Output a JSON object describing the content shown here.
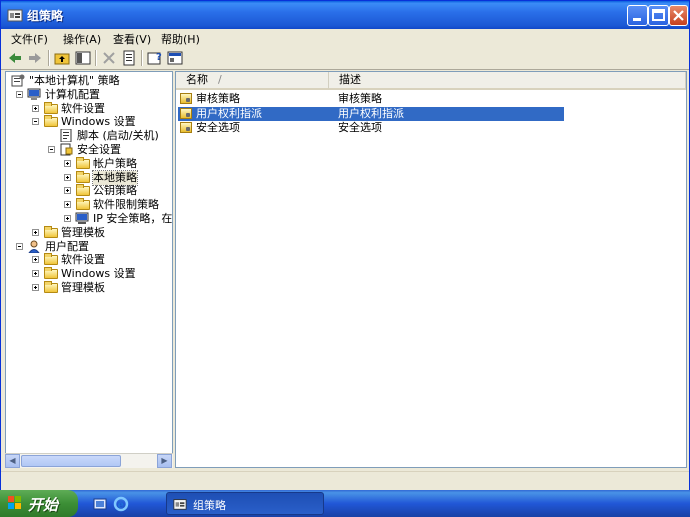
{
  "window": {
    "title": "组策略"
  },
  "menu": [
    {
      "label": "文件(F)"
    },
    {
      "label": "操作(A)"
    },
    {
      "label": "查看(V)"
    },
    {
      "label": "帮助(H)"
    }
  ],
  "toolbar": {
    "icons": [
      "back-arrow-icon",
      "forward-arrow-icon",
      "up-folder-icon",
      "show-hide-tree-icon",
      "delete-icon",
      "properties-icon",
      "help-icon",
      "console-icon"
    ]
  },
  "tree": [
    {
      "label": "\"本地计算机\" 策略",
      "level": 0,
      "expander": "none",
      "icon": "policy-icon"
    },
    {
      "label": "计算机配置",
      "level": 1,
      "expander": "minus",
      "icon": "computer-icon"
    },
    {
      "label": "软件设置",
      "level": 2,
      "expander": "plus",
      "icon": "folder-icon"
    },
    {
      "label": "Windows 设置",
      "level": 2,
      "expander": "minus",
      "icon": "folder-icon"
    },
    {
      "label": "脚本 (启动/关机)",
      "level": 3,
      "expander": "none",
      "icon": "script-icon"
    },
    {
      "label": "安全设置",
      "level": 3,
      "expander": "minus",
      "icon": "security-icon"
    },
    {
      "label": "帐户策略",
      "level": 4,
      "expander": "plus",
      "icon": "folder-icon"
    },
    {
      "label": "本地策略",
      "level": 4,
      "expander": "plus",
      "icon": "folder-icon",
      "selected": true
    },
    {
      "label": "公钥策略",
      "level": 4,
      "expander": "plus",
      "icon": "folder-icon"
    },
    {
      "label": "软件限制策略",
      "level": 4,
      "expander": "plus",
      "icon": "folder-icon"
    },
    {
      "label": "IP 安全策略，在",
      "level": 4,
      "expander": "plus",
      "icon": "ip-security-icon"
    },
    {
      "label": "管理模板",
      "level": 2,
      "expander": "plus",
      "icon": "folder-icon"
    },
    {
      "label": "用户配置",
      "level": 1,
      "expander": "minus",
      "icon": "user-icon"
    },
    {
      "label": "软件设置",
      "level": 2,
      "expander": "plus",
      "icon": "folder-icon"
    },
    {
      "label": "Windows 设置",
      "level": 2,
      "expander": "plus",
      "icon": "folder-icon"
    },
    {
      "label": "管理模板",
      "level": 2,
      "expander": "plus",
      "icon": "folder-icon"
    }
  ],
  "list": {
    "columns": [
      "名称",
      "描述"
    ],
    "sort_indicator": "/",
    "rows": [
      {
        "name": "审核策略",
        "desc": "审核策略",
        "selected": false
      },
      {
        "name": "用户权利指派",
        "desc": "用户权利指派",
        "selected": true
      },
      {
        "name": "安全选项",
        "desc": "安全选项",
        "selected": false
      }
    ]
  },
  "taskbar": {
    "start_label": "开始",
    "task_title": "组策略"
  }
}
